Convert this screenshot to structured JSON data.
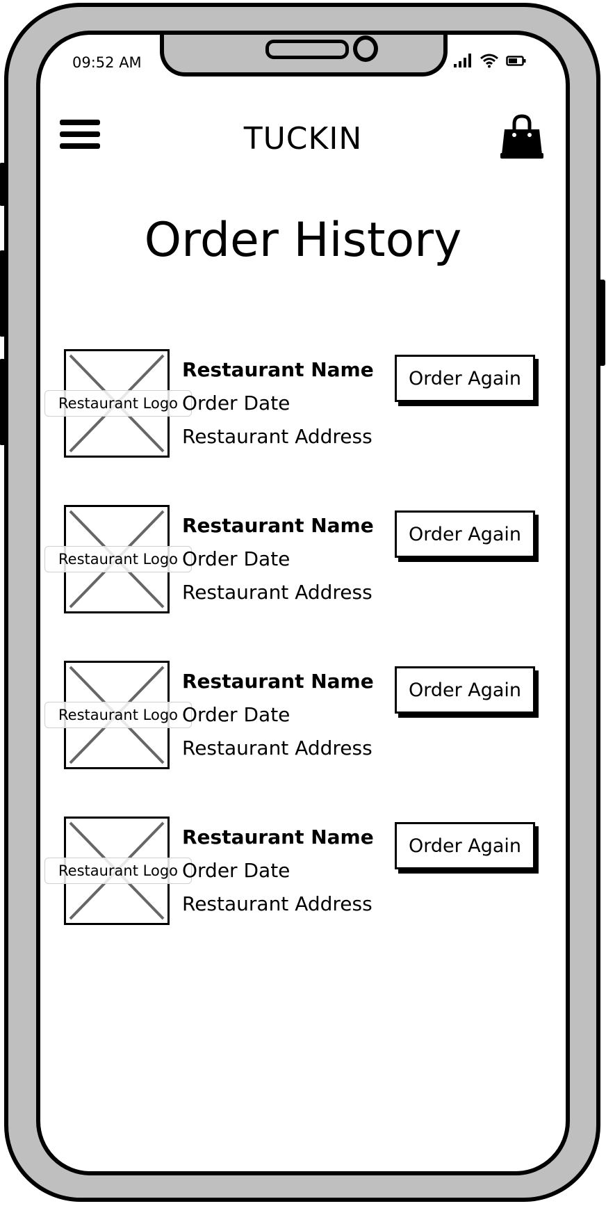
{
  "status_bar": {
    "time": "09:52 AM",
    "icons": [
      "signal-icon",
      "wifi-icon",
      "battery-icon"
    ]
  },
  "header": {
    "menu_icon": "hamburger-menu-icon",
    "app_title": "TUCKIN",
    "cart_icon": "shopping-bag-icon"
  },
  "page": {
    "title": "Order History"
  },
  "orders": [
    {
      "logo_label": "Restaurant Logo",
      "name": "Restaurant Name",
      "date": "Order Date",
      "address": "Restaurant Address",
      "button": "Order Again"
    },
    {
      "logo_label": "Restaurant Logo",
      "name": "Restaurant Name",
      "date": "Order Date",
      "address": "Restaurant Address",
      "button": "Order Again"
    },
    {
      "logo_label": "Restaurant Logo",
      "name": "Restaurant Name",
      "date": "Order Date",
      "address": "Restaurant Address",
      "button": "Order Again"
    },
    {
      "logo_label": "Restaurant Logo",
      "name": "Restaurant Name",
      "date": "Order Date",
      "address": "Restaurant Address",
      "button": "Order Again"
    }
  ],
  "colors": {
    "frame": "#bfbfbf",
    "outline": "#000000",
    "placeholder_cross": "#666666"
  }
}
